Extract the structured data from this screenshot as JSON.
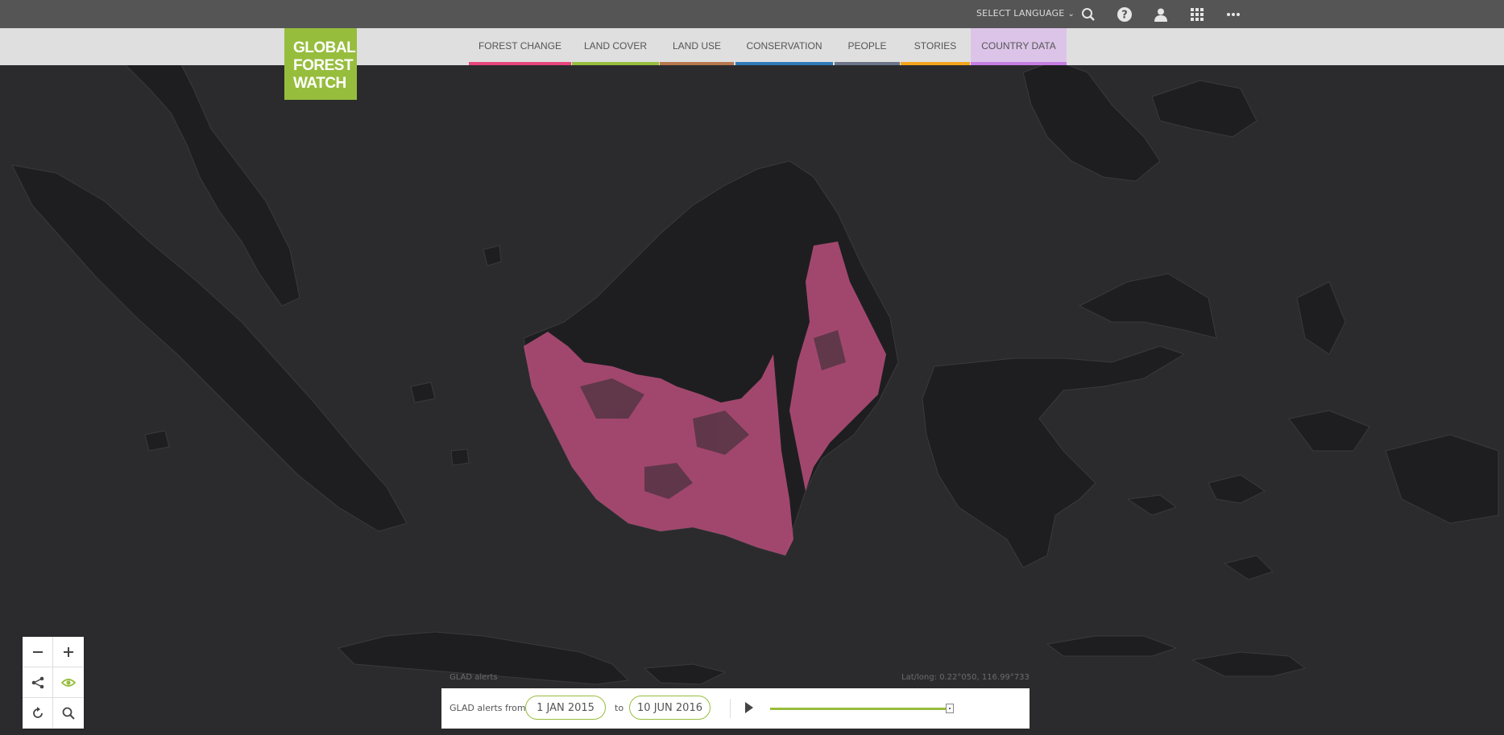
{
  "header": {
    "language_label": "SELECT LANGUAGE",
    "icons": [
      "search-icon",
      "help-icon",
      "user-icon",
      "apps-grid-icon",
      "more-icon"
    ]
  },
  "logo": {
    "line1": "GLOBAL",
    "line2": "FOREST",
    "line3": "WATCH",
    "color": "#97bd3d"
  },
  "nav": {
    "items": [
      {
        "label": "FOREST CHANGE",
        "color": "#e9457c"
      },
      {
        "label": "LAND COVER",
        "color": "#97bd3d"
      },
      {
        "label": "LAND USE",
        "color": "#b5774d"
      },
      {
        "label": "CONSERVATION",
        "color": "#2f79b9"
      },
      {
        "label": "PEOPLE",
        "color": "#6b7587"
      },
      {
        "label": "STORIES",
        "color": "#f4a41d"
      },
      {
        "label": "COUNTRY DATA",
        "color": "#c77ee3"
      }
    ]
  },
  "map": {
    "layer_label": "GLAD alerts",
    "coords_label": "Lat/long: 0.22°050, 116.99°733",
    "alert_color": "#b94f7c",
    "land_color": "#1e1e20",
    "water_color": "#2b2b2d"
  },
  "controls": {
    "icons": [
      "zoom-out-icon",
      "zoom-in-icon",
      "share-icon",
      "eye-icon",
      "reset-icon",
      "search-icon"
    ]
  },
  "timeline": {
    "prefix": "GLAD alerts from",
    "start_date": "1 JAN 2015",
    "to_label": "to",
    "end_date": "10 JUN 2016",
    "progress": 1.0
  }
}
